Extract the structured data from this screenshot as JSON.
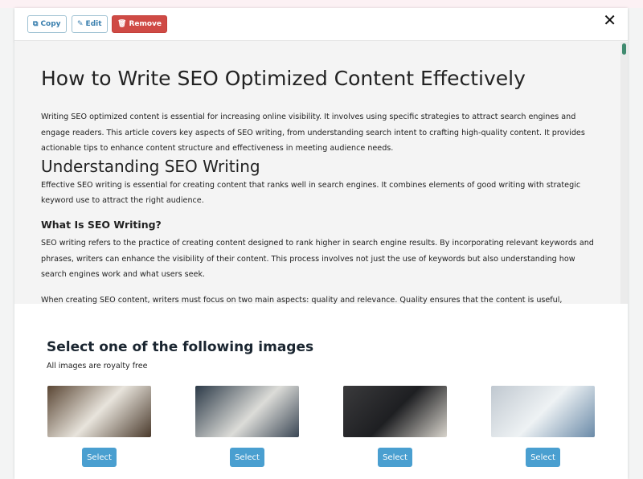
{
  "toolbar": {
    "copy": "Copy",
    "edit": "Edit",
    "remove": "Remove",
    "close": "✕"
  },
  "article": {
    "title": "How to Write SEO Optimized Content Effectively",
    "intro": "Writing SEO optimized content is essential for increasing online visibility. It involves using specific strategies to attract search engines and engage readers. This article covers key aspects of SEO writing, from understanding search intent to crafting high-quality content. It provides actionable tips to enhance content structure and effectiveness in meeting audience needs.",
    "h2": "Understanding SEO Writing",
    "p2": "Effective SEO writing is essential for creating content that ranks well in search engines. It combines elements of good writing with strategic keyword use to attract the right audience.",
    "h3": "What Is SEO Writing?",
    "p3": "SEO writing refers to the practice of creating content designed to rank higher in search engine results. By incorporating relevant keywords and phrases, writers can enhance the visibility of their content. This process involves not just the use of keywords but also understanding how search engines work and what users seek.",
    "p4": "When creating SEO content, writers must focus on two main aspects: quality and relevance. Quality ensures that the content is useful, engaging, and easy to"
  },
  "images": {
    "title": "Select one of the following images",
    "subtitle": "All images are royalty free",
    "select_label": "Select",
    "colors": [
      "#6a5a4a",
      "#3c4a58",
      "#2d2e31",
      "#a8b4c0"
    ]
  }
}
